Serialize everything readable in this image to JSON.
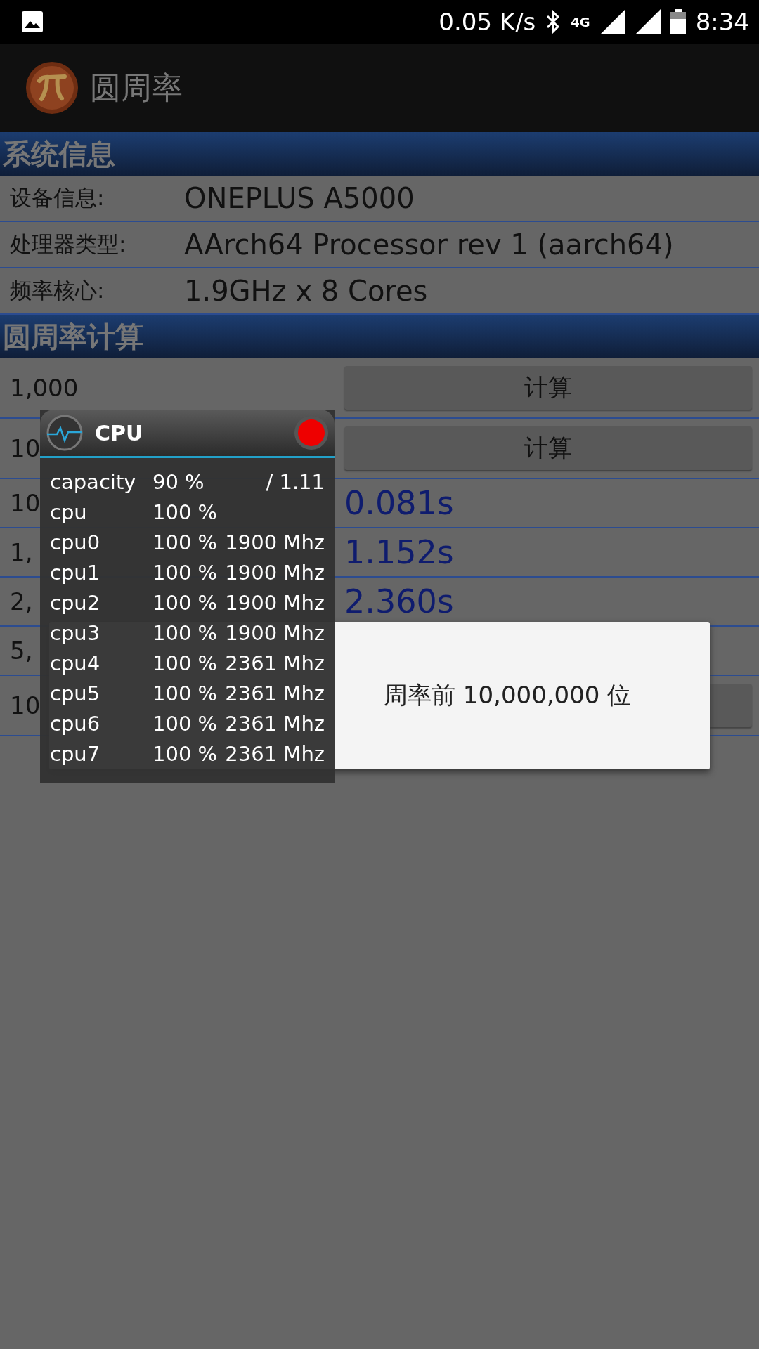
{
  "status_bar": {
    "speed": "0.05 K/s",
    "network": "4G",
    "time": "8:34"
  },
  "app_bar": {
    "title": "圆周率"
  },
  "system_section": {
    "title": "系统信息",
    "rows": [
      {
        "label": "设备信息:",
        "value": "ONEPLUS A5000"
      },
      {
        "label": "处理器类型:",
        "value": "AArch64 Processor rev 1 (aarch64)"
      },
      {
        "label": "频率核心:",
        "value": "1.9GHz x 8 Cores"
      }
    ]
  },
  "pi_section": {
    "title": "圆周率计算",
    "rows": [
      {
        "digits": "1,000",
        "kind": "button",
        "button": "计算"
      },
      {
        "digits": "10",
        "kind": "button",
        "button": "计算"
      },
      {
        "digits": "10",
        "kind": "result",
        "result": "0.081s"
      },
      {
        "digits": "1,",
        "kind": "result",
        "result": "1.152s"
      },
      {
        "digits": "2,",
        "kind": "result",
        "result": "2.360s"
      },
      {
        "digits": "5,",
        "kind": "blank"
      },
      {
        "digits": "10",
        "kind": "button"
      }
    ]
  },
  "progress_dialog": {
    "message": "周率前 10,000,000 位"
  },
  "cpu_overlay": {
    "title": "CPU",
    "rows": [
      {
        "name": "capacity",
        "percent": "90 %",
        "extra": "/ 1.11"
      },
      {
        "name": "cpu",
        "percent": "100 %"
      },
      {
        "name": "cpu0",
        "percent": "100 %",
        "extra": "1900 Mhz"
      },
      {
        "name": "cpu1",
        "percent": "100 %",
        "extra": "1900 Mhz"
      },
      {
        "name": "cpu2",
        "percent": "100 %",
        "extra": "1900 Mhz"
      },
      {
        "name": "cpu3",
        "percent": "100 %",
        "extra": "1900 Mhz"
      },
      {
        "name": "cpu4",
        "percent": "100 %",
        "extra": "2361 Mhz"
      },
      {
        "name": "cpu5",
        "percent": "100 %",
        "extra": "2361 Mhz"
      },
      {
        "name": "cpu6",
        "percent": "100 %",
        "extra": "2361 Mhz"
      },
      {
        "name": "cpu7",
        "percent": "100 %",
        "extra": "2361 Mhz"
      }
    ]
  }
}
